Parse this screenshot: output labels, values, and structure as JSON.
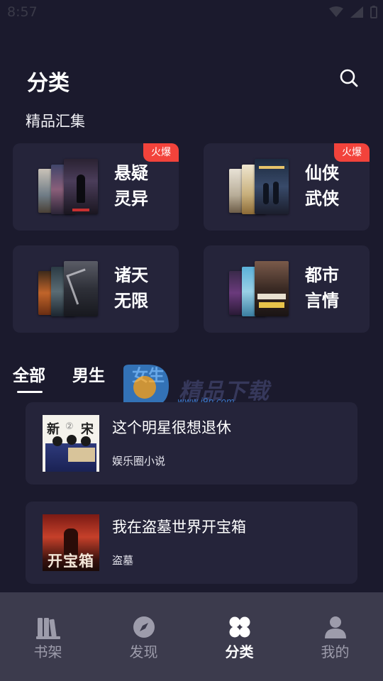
{
  "status_bar": {
    "time": "8:57"
  },
  "header": {
    "title": "分类"
  },
  "section": {
    "title": "精品汇集"
  },
  "categories": [
    {
      "label_line1": "悬疑",
      "label_line2": "灵异",
      "hot": "火爆"
    },
    {
      "label_line1": "仙侠",
      "label_line2": "武侠",
      "hot": "火爆"
    },
    {
      "label_line1": "诸天",
      "label_line2": "无限"
    },
    {
      "label_line1": "都市",
      "label_line2": "言情"
    }
  ],
  "tabs": [
    {
      "label": "全部",
      "selected": true
    },
    {
      "label": "男生",
      "selected": false
    },
    {
      "label": "女生",
      "selected": false
    }
  ],
  "watermark": {
    "text": "精品下载",
    "url": "www.j9p.com"
  },
  "books": [
    {
      "title": "这个明星很想退休",
      "tag": "娱乐圈小说",
      "cover_text_1": "新",
      "cover_text_2": "宋",
      "cover_text_3": "②"
    },
    {
      "title": "我在盗墓世界开宝箱",
      "tag": "盗墓",
      "cover_text": "开宝箱"
    }
  ],
  "bottom_nav": [
    {
      "label": "书架",
      "icon": "bookshelf-icon",
      "active": false
    },
    {
      "label": "发现",
      "icon": "compass-icon",
      "active": false
    },
    {
      "label": "分类",
      "icon": "category-grid-icon",
      "active": true
    },
    {
      "label": "我的",
      "icon": "person-icon",
      "active": false
    }
  ],
  "colors": {
    "background": "#1b1a2d",
    "card": "#25243a",
    "hot_badge": "#f2433b",
    "navbar": "#3c3b4d",
    "nav_inactive": "#9d9cab"
  }
}
